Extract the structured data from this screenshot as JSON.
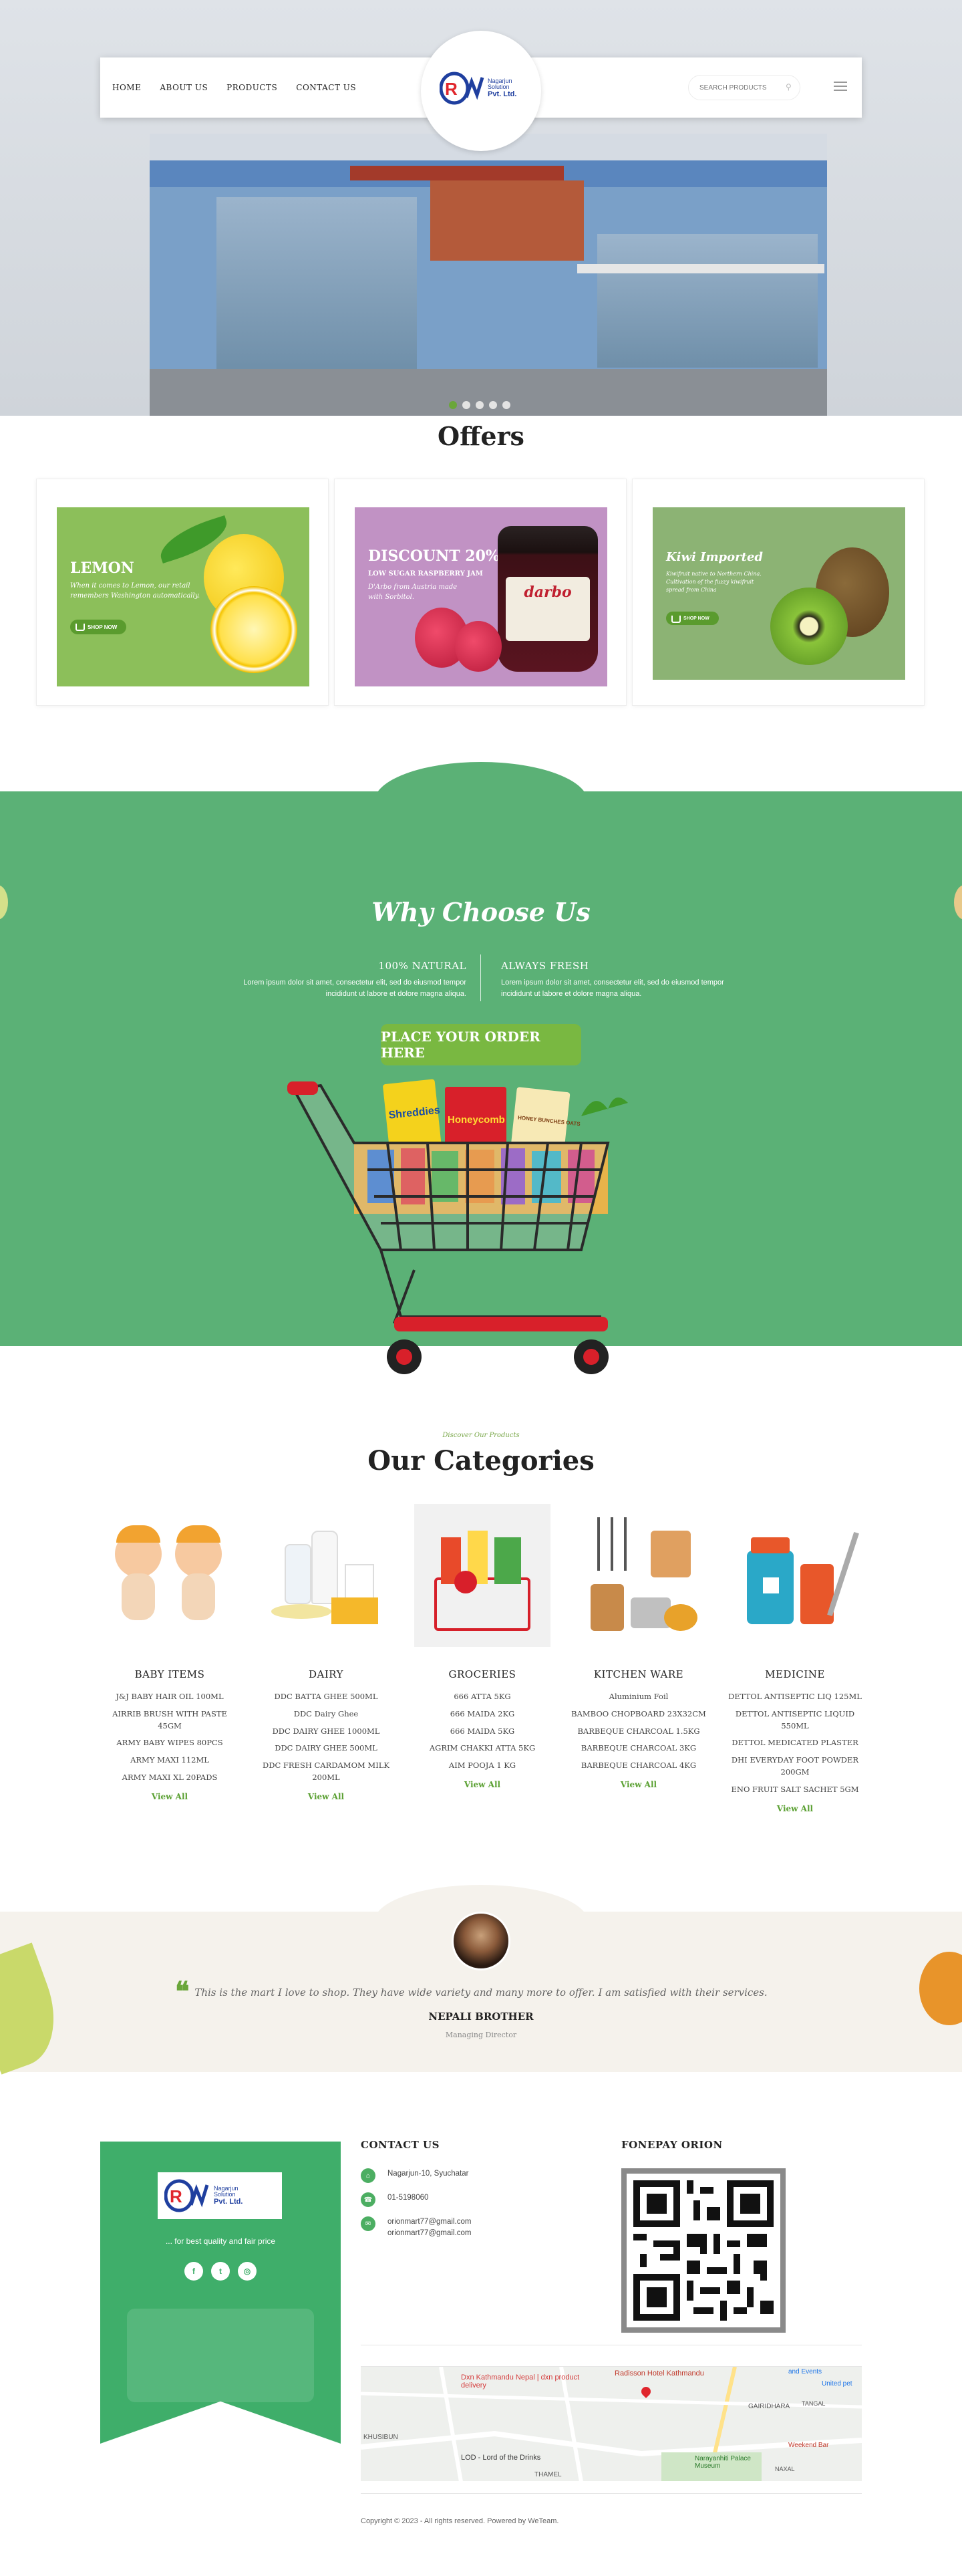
{
  "nav": {
    "links": [
      "HOME",
      "ABOUT US",
      "PRODUCTS",
      "CONTACT US"
    ],
    "search_placeholder": "SEARCH PRODUCTS",
    "logo": {
      "line1": "Nagarjun",
      "line2": "Solution",
      "line3": "Pvt. Ltd."
    }
  },
  "offers": {
    "title": "Offers",
    "cards": [
      {
        "title": "LEMON",
        "sub": "",
        "desc": "When it comes to Lemon, our retail remembers Washington automatically.",
        "button": "SHOP NOW"
      },
      {
        "title": "DISCOUNT 20%",
        "sub": "LOW SUGAR RASPBERRY JAM",
        "desc": "D'Arbo from Austria made with Sorbitol.",
        "button": ""
      },
      {
        "title": "Kiwi Imported",
        "sub": "",
        "desc": "Kiwifruit native to Northern China. Cultivation of the fuzzy kiwifruit spread from China",
        "button": "SHOP NOW"
      }
    ],
    "jar_label": "darbo"
  },
  "why": {
    "title": "Why Choose Us",
    "col1": {
      "title": "100% NATURAL",
      "text": "Lorem ipsum dolor sit amet, consectetur elit, sed do eiusmod tempor incididunt ut labore et dolore magna aliqua."
    },
    "col2": {
      "title": "ALWAYS FRESH",
      "text": "Lorem ipsum dolor sit amet, consectetur elit, sed do eiusmod tempor incididunt ut labore et dolore magna aliqua."
    },
    "button": "PLACE YOUR ORDER HERE",
    "cart_brands": [
      "Shreddies",
      "Honeycomb",
      "HONEY BUNCHES OATS"
    ]
  },
  "categories": {
    "eyebrow": "Discover Our Products",
    "title_light": "Our",
    "title_bold": "Categories",
    "view_all": "View All",
    "items": [
      {
        "name": "BABY ITEMS",
        "products": [
          "J&J BABY HAIR OIL 100ML",
          "AIRRIB BRUSH WITH PASTE 45GM",
          "ARMY BABY WIPES 80PCS",
          "ARMY MAXI 112ML",
          "ARMY MAXI XL 20PADS"
        ]
      },
      {
        "name": "DAIRY",
        "products": [
          "DDC BATTA GHEE 500ML",
          "DDC Dairy Ghee",
          "DDC DAIRY GHEE 1000ML",
          "DDC DAIRY GHEE 500ML",
          "DDC FRESH CARDAMOM MILK 200ML"
        ]
      },
      {
        "name": "GROCERIES",
        "products": [
          "666 ATTA 5KG",
          "666 MAIDA 2KG",
          "666 MAIDA 5KG",
          "AGRIM CHAKKI ATTA 5KG",
          "AIM POOJA 1 KG"
        ]
      },
      {
        "name": "KITCHEN WARE",
        "products": [
          "Aluminium Foil",
          "BAMBOO CHOPBOARD 23X32CM",
          "BARBEQUE CHARCOAL 1.5KG",
          "BARBEQUE CHARCOAL 3KG",
          "BARBEQUE CHARCOAL 4KG"
        ]
      },
      {
        "name": "MEDICINE",
        "products": [
          "DETTOL ANTISEPTIC LIQ 125ML",
          "DETTOL ANTISEPTIC LIQUID 550ML",
          "DETTOL MEDICATED PLASTER",
          "DHI EVERYDAY FOOT POWDER 200GM",
          "ENO FRUIT SALT SACHET 5GM"
        ]
      }
    ]
  },
  "testimonial": {
    "quote": "This is the mart I love to shop. They have wide variety and many more to offer. I am satisfied with their services.",
    "name": "NEPALI BROTHER",
    "role": "Managing Director"
  },
  "footer": {
    "tagline": "... for best quality and fair price",
    "social": [
      "f",
      "t",
      "◎"
    ],
    "contact_title": "CONTACT US",
    "address": "Nagarjun-10, Syuchatar",
    "phone": "01-5198060",
    "email1": "orionmart77@gmail.com",
    "email2": "orionmart77@gmail.com",
    "fonepay_title": "FONEPAY ORION",
    "map_labels": [
      "Dxn Kathmandu Nepal | dxn product delivery",
      "Radisson Hotel Kathmandu",
      "KHUSIBUN",
      "GAIRIDHARA",
      "LOD - Lord of the Drinks",
      "Narayanhiti Palace Museum",
      "Weekend Bar",
      "United pet",
      "THAMEL",
      "TANGAL",
      "and Events",
      "NAXAL"
    ],
    "copyright": "Copyright © 2023 - All rights reserved. Powered by WeTeam."
  },
  "colors": {
    "green": "#5bb176",
    "accent": "#79b841",
    "footer_green": "#3fae6a",
    "cream": "#f5f2ec"
  }
}
